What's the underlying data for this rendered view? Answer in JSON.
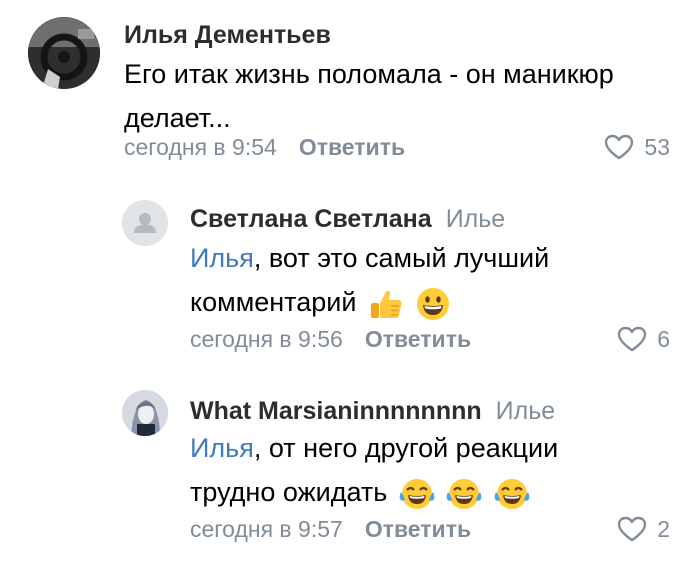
{
  "colors": {
    "author": "#2c2d2e",
    "secondary": "#818c99",
    "mention": "#3f7bbd",
    "text": "#000000"
  },
  "comments": [
    {
      "author": "Илья Дементьев",
      "reply_to": "",
      "mention": "",
      "text": "Его итак жизнь поломала - он маникюр делает...",
      "emojis": [],
      "time": "сегодня в 9:54",
      "reply_label": "Ответить",
      "likes": "53",
      "avatar": "car-steering-wheel-photo"
    },
    {
      "author": "Светлана Светлана",
      "reply_to": "Илье",
      "mention": "Илья",
      "text": ", вот это самый лучший комментарий",
      "emojis": [
        "thumbs-up-emoji",
        "grinning-face-emoji"
      ],
      "time": "сегодня в 9:56",
      "reply_label": "Ответить",
      "likes": "6",
      "avatar": "default-user-avatar"
    },
    {
      "author": "What Marsianinnnnnnnn",
      "reply_to": "Илье",
      "mention": "Илья",
      "text": ", от него другой реакции трудно ожидать",
      "emojis": [
        "tears-of-joy-emoji",
        "tears-of-joy-emoji",
        "tears-of-joy-emoji"
      ],
      "time": "сегодня в 9:57",
      "reply_label": "Ответить",
      "likes": "2",
      "avatar": "anime-character-avatar"
    }
  ]
}
